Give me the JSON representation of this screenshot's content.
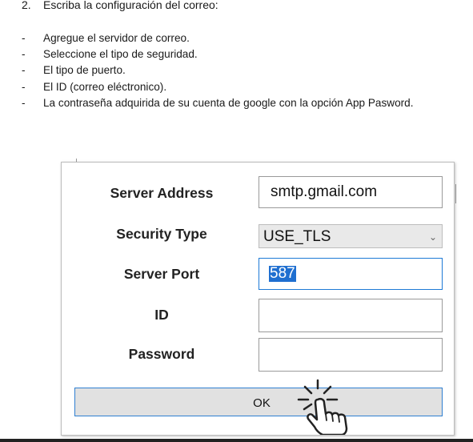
{
  "doc": {
    "step_number": "2.",
    "step_text": "Escriba la configuración del correo:",
    "bullet_marker": "-",
    "bullets": [
      "Agregue el servidor de correo.",
      "Seleccione el tipo de seguridad.",
      "El tipo de puerto.",
      "El ID (correo eléctronico).",
      "La contraseña adquirida de su cuenta de google con la opción App Pasword."
    ]
  },
  "dialog": {
    "server_address_label": "Server Address",
    "server_address_value": "smtp.gmail.com",
    "security_type_label": "Security Type",
    "security_type_value": "USE_TLS",
    "server_port_label": "Server Port",
    "server_port_value": "587",
    "id_label": "ID",
    "id_value": "",
    "password_label": "Password",
    "password_value": "",
    "ok_label": "OK"
  },
  "icons": {
    "dropdown": "chevron-down-icon",
    "pointer": "hand-pointer-icon"
  },
  "colors": {
    "focus_border": "#1e7ad6",
    "selection": "#1f6fd0",
    "button_bg": "#e1e1e1"
  }
}
